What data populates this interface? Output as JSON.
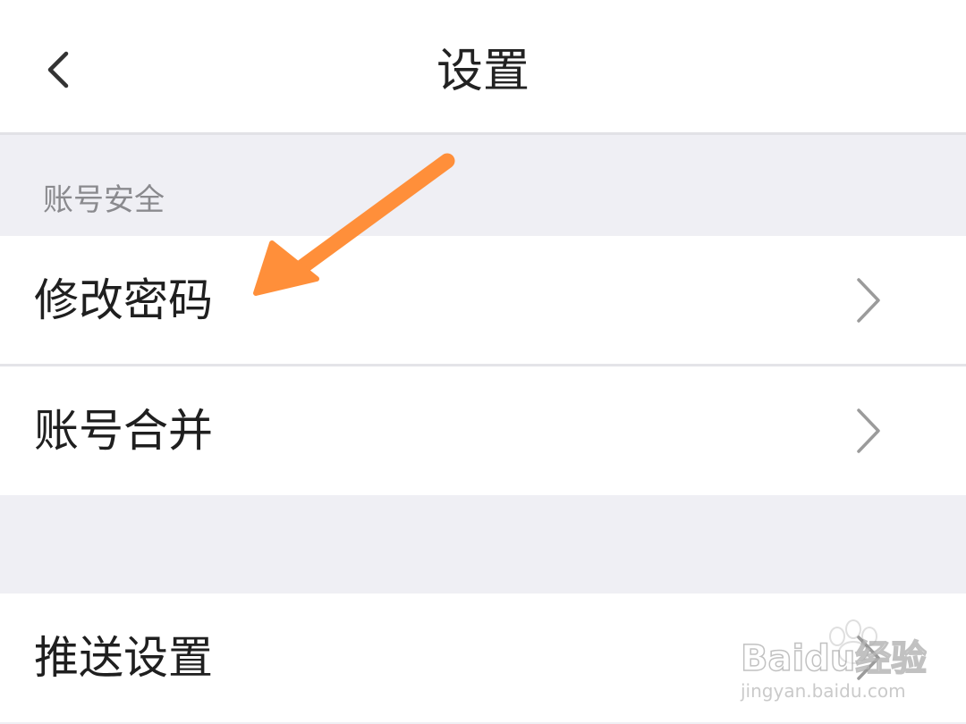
{
  "header": {
    "title": "设置",
    "back_icon": "chevron-left-icon"
  },
  "sections": [
    {
      "label": "账号安全",
      "items": [
        {
          "label": "修改密码",
          "icon": "chevron-right-icon"
        },
        {
          "label": "账号合并",
          "icon": "chevron-right-icon"
        }
      ]
    },
    {
      "label": "",
      "items": [
        {
          "label": "推送设置",
          "icon": "chevron-right-icon"
        }
      ]
    }
  ],
  "annotation": {
    "type": "arrow",
    "color": "#ff8f3a"
  },
  "watermark": {
    "brand": "Baidu经验",
    "url": "jingyan.baidu.com"
  },
  "colors": {
    "background": "#efeff4",
    "surface": "#ffffff",
    "text_primary": "#1f1f1f",
    "text_secondary": "#8a8a8e",
    "chevron": "#9b9b9b"
  }
}
